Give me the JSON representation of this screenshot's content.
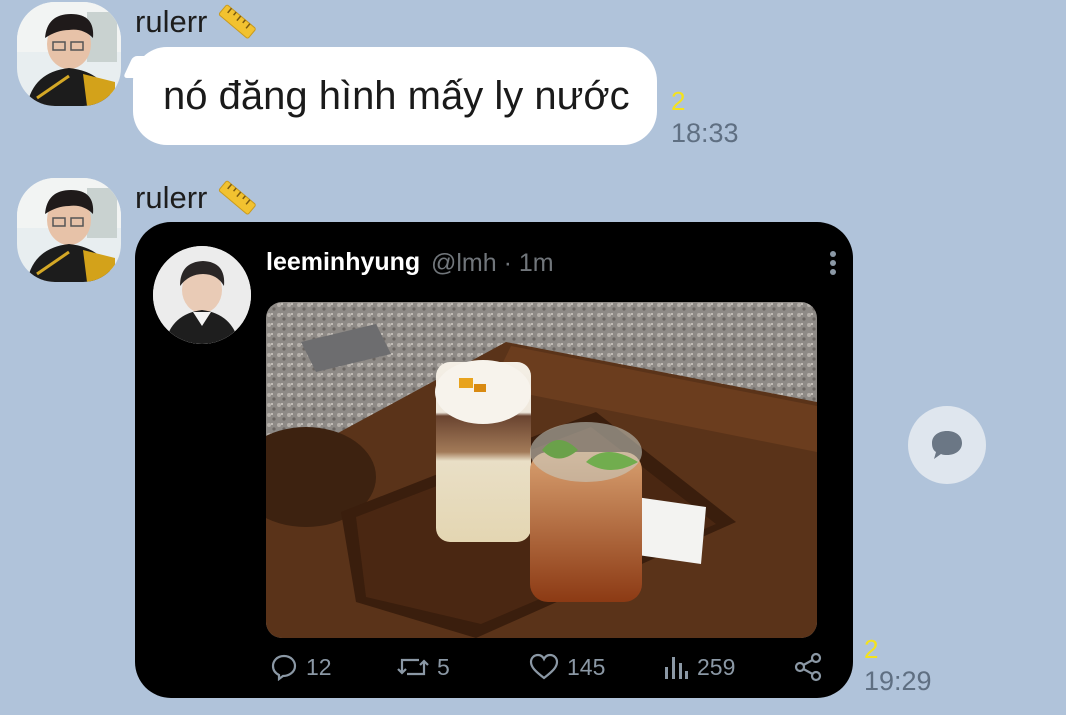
{
  "messages": [
    {
      "sender": "rulerr",
      "text": "nó đăng hình mấy ly nước",
      "unread": "2",
      "time": "18:33"
    },
    {
      "sender": "rulerr",
      "unread": "2",
      "time": "19:29",
      "tweet": {
        "name": "leeminhyung",
        "handle": "@lmh · 1m",
        "replies": "12",
        "retweets": "5",
        "likes": "145",
        "views": "259"
      }
    }
  ],
  "icons": {
    "sender_badge": "ruler-icon",
    "more": "more-vertical-icon",
    "reply": "reply-icon",
    "retweet": "retweet-icon",
    "like": "heart-icon",
    "views": "views-icon",
    "share": "share-icon",
    "side_action": "comment-bubble-icon"
  },
  "colors": {
    "background": "#b0c3da",
    "bubble": "#ffffff",
    "unread": "#f4e21d",
    "tweet_card": "#000000",
    "tweet_muted": "#71767b"
  }
}
